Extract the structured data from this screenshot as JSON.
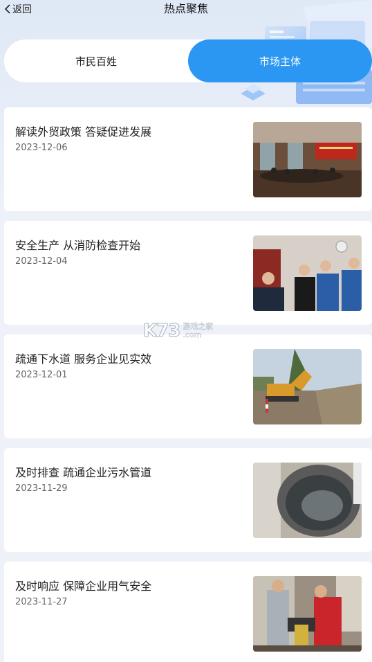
{
  "header": {
    "back_label": "返回",
    "title": "热点聚焦"
  },
  "tabs": [
    {
      "label": "市民百姓",
      "active": false
    },
    {
      "label": "市场主体",
      "active": true
    }
  ],
  "accent_color": "#2b97f2",
  "articles": [
    {
      "title": "解读外贸政策 答疑促进发展",
      "date": "2023-12-06",
      "image": "meeting-room-photo"
    },
    {
      "title": "安全生产  从消防检查开始",
      "date": "2023-12-04",
      "image": "fire-inspection-photo"
    },
    {
      "title": "疏通下水道  服务企业见实效",
      "date": "2023-12-01",
      "image": "excavator-photo"
    },
    {
      "title": "及时排查  疏通企业污水管道",
      "date": "2023-11-29",
      "image": "sewer-pipe-photo"
    },
    {
      "title": "及时响应 保障企业用气安全",
      "date": "2023-11-27",
      "image": "gas-check-photo"
    }
  ],
  "watermark": {
    "logo": "K73",
    "text_cn": "游戏之家",
    "domain": ".com"
  }
}
